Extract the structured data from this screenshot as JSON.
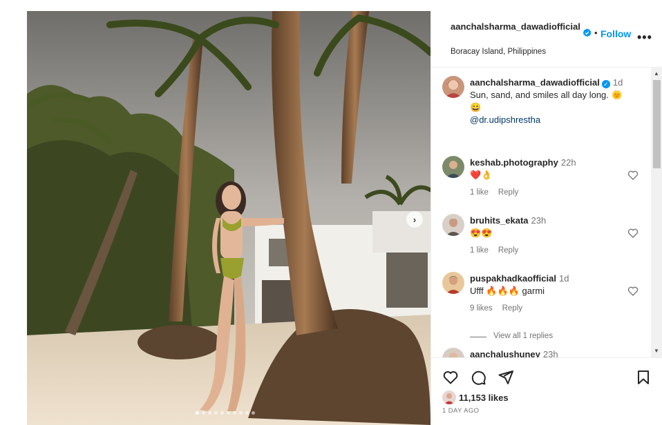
{
  "post": {
    "author": "aanchalsharma_dawadiofficial",
    "location": "Boracay Island, Philippines",
    "follow_label": "Follow",
    "separator": "•",
    "more_label": "•••",
    "carousel_total": 10,
    "carousel_index": 1
  },
  "caption": {
    "username": "aanchalsharma_dawadiofficial",
    "time": "1d",
    "text": "Sun, sand, and smiles all day long. 🌞",
    "emoji_line": "😄",
    "mention": "@dr.udipshrestha"
  },
  "comments": [
    {
      "username": "keshab.photography",
      "time": "22h",
      "text": "❤️👌",
      "likes": "1 like",
      "reply": "Reply"
    },
    {
      "username": "bruhits_ekata",
      "time": "23h",
      "text": "😍😍",
      "likes": "1 like",
      "reply": "Reply"
    },
    {
      "username": "puspakhadkaofficial",
      "time": "1d",
      "text": "Ufff 🔥🔥🔥 garmi",
      "likes": "9 likes",
      "reply": "Reply",
      "view_replies": "View all 1 replies"
    },
    {
      "username": "aanchalushuney",
      "time": "23h"
    }
  ],
  "footer": {
    "likes": "11,153 likes",
    "ago": "1 DAY AGO"
  },
  "icons": [
    "heart-icon",
    "comment-icon",
    "share-icon",
    "bookmark-icon",
    "verified-badge-icon",
    "chevron-right-icon"
  ],
  "colors": {
    "follow": "#0095f6",
    "verified": "#0095f6",
    "muted": "#737373"
  }
}
